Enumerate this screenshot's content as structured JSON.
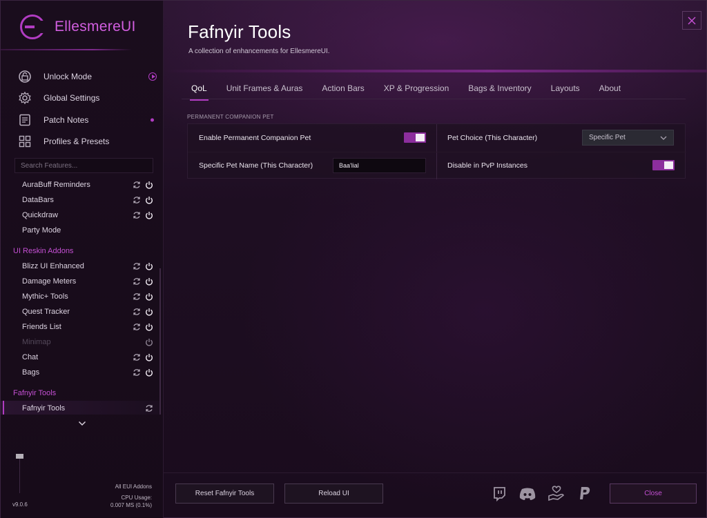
{
  "app": {
    "logo_text": "EllesmereUI",
    "version": "v9.0.6",
    "cpu_scope": "All EUI Addons",
    "cpu_label": "CPU Usage:",
    "cpu_value": "0.007 MS (0.1%)"
  },
  "nav": {
    "items": [
      {
        "label": "Unlock Mode",
        "icon": "unlock-icon"
      },
      {
        "label": "Global Settings",
        "icon": "gear-icon"
      },
      {
        "label": "Patch Notes",
        "icon": "notes-icon"
      },
      {
        "label": "Profiles & Presets",
        "icon": "grid-icon"
      }
    ]
  },
  "search": {
    "placeholder": "Search Features..."
  },
  "features": {
    "group1": [
      {
        "label": "AuraBuff Reminders"
      },
      {
        "label": "DataBars"
      },
      {
        "label": "Quickdraw"
      },
      {
        "label": "Party Mode"
      }
    ],
    "section_reskin": "UI Reskin Addons",
    "reskin": [
      {
        "label": "Blizz UI Enhanced"
      },
      {
        "label": "Damage Meters"
      },
      {
        "label": "Mythic+ Tools"
      },
      {
        "label": "Quest Tracker"
      },
      {
        "label": "Friends List"
      },
      {
        "label": "Minimap"
      },
      {
        "label": "Chat"
      },
      {
        "label": "Bags"
      }
    ],
    "section_fafnyir": "Fafnyir Tools",
    "fafnyir": [
      {
        "label": "Fafnyir Tools"
      }
    ]
  },
  "main": {
    "title": "Fafnyir Tools",
    "subtitle": "A collection of enhancements for EllesmereUI.",
    "tabs": [
      {
        "label": "QoL",
        "active": true
      },
      {
        "label": "Unit Frames & Auras"
      },
      {
        "label": "Action Bars"
      },
      {
        "label": "XP & Progression"
      },
      {
        "label": "Bags & Inventory"
      },
      {
        "label": "Layouts"
      },
      {
        "label": "About"
      }
    ],
    "section_label": "PERMANENT COMPANION PET",
    "options": {
      "enable_pet_label": "Enable Permanent Companion Pet",
      "enable_pet_on": true,
      "pet_choice_label": "Pet Choice (This Character)",
      "pet_choice_value": "Specific Pet",
      "pet_name_label": "Specific Pet Name (This Character)",
      "pet_name_value": "Baa'lial",
      "disable_pvp_label": "Disable in PvP Instances",
      "disable_pvp_on": true
    }
  },
  "footer": {
    "reset_label": "Reset Fafnyir Tools",
    "reload_label": "Reload UI",
    "close_label": "Close",
    "socials": [
      "twitch-icon",
      "discord-icon",
      "donate-icon",
      "paypal-icon"
    ]
  },
  "colors": {
    "accent": "#b13cc2",
    "toggle_on": "#8c2e9d",
    "background": "#1c0f1f"
  }
}
